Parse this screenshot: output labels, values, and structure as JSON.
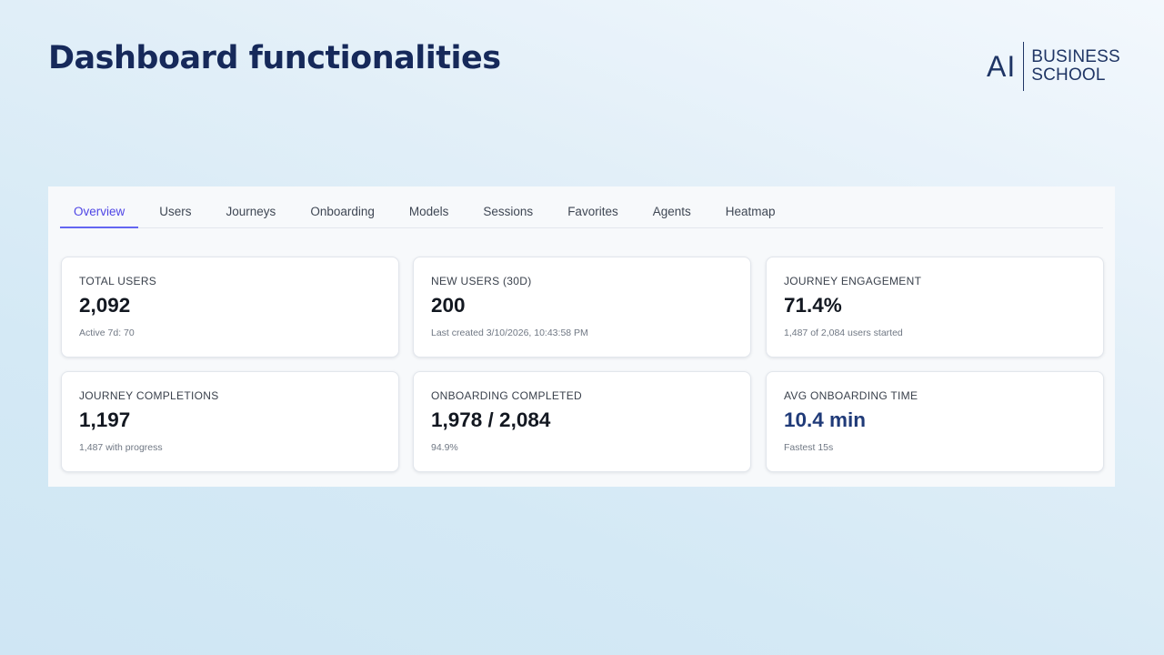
{
  "slide": {
    "title": "Dashboard functionalities"
  },
  "logo": {
    "mark": "AI",
    "line1": "BUSINESS",
    "line2": "SCHOOL"
  },
  "tabs": [
    {
      "label": "Overview",
      "active": true
    },
    {
      "label": "Users",
      "active": false
    },
    {
      "label": "Journeys",
      "active": false
    },
    {
      "label": "Onboarding",
      "active": false
    },
    {
      "label": "Models",
      "active": false
    },
    {
      "label": "Sessions",
      "active": false
    },
    {
      "label": "Favorites",
      "active": false
    },
    {
      "label": "Agents",
      "active": false
    },
    {
      "label": "Heatmap",
      "active": false
    }
  ],
  "cards": [
    {
      "label": "TOTAL USERS",
      "value": "2,092",
      "sub": "Active 7d: 70"
    },
    {
      "label": "NEW USERS (30D)",
      "value": "200",
      "sub": "Last created 3/10/2026, 10:43:58 PM"
    },
    {
      "label": "JOURNEY ENGAGEMENT",
      "value": "71.4%",
      "sub": "1,487 of 2,084 users started"
    },
    {
      "label": "JOURNEY COMPLETIONS",
      "value": "1,197",
      "sub": "1,487 with progress"
    },
    {
      "label": "ONBOARDING COMPLETED",
      "value": "1,978 / 2,084",
      "sub": "94.9%"
    },
    {
      "label": "AVG ONBOARDING TIME",
      "value": "10.4 min",
      "sub": "Fastest 15s"
    }
  ],
  "colors": {
    "title": "#16295a",
    "active_tab": "#4f46e5",
    "accent_value": "#1f3a78"
  }
}
